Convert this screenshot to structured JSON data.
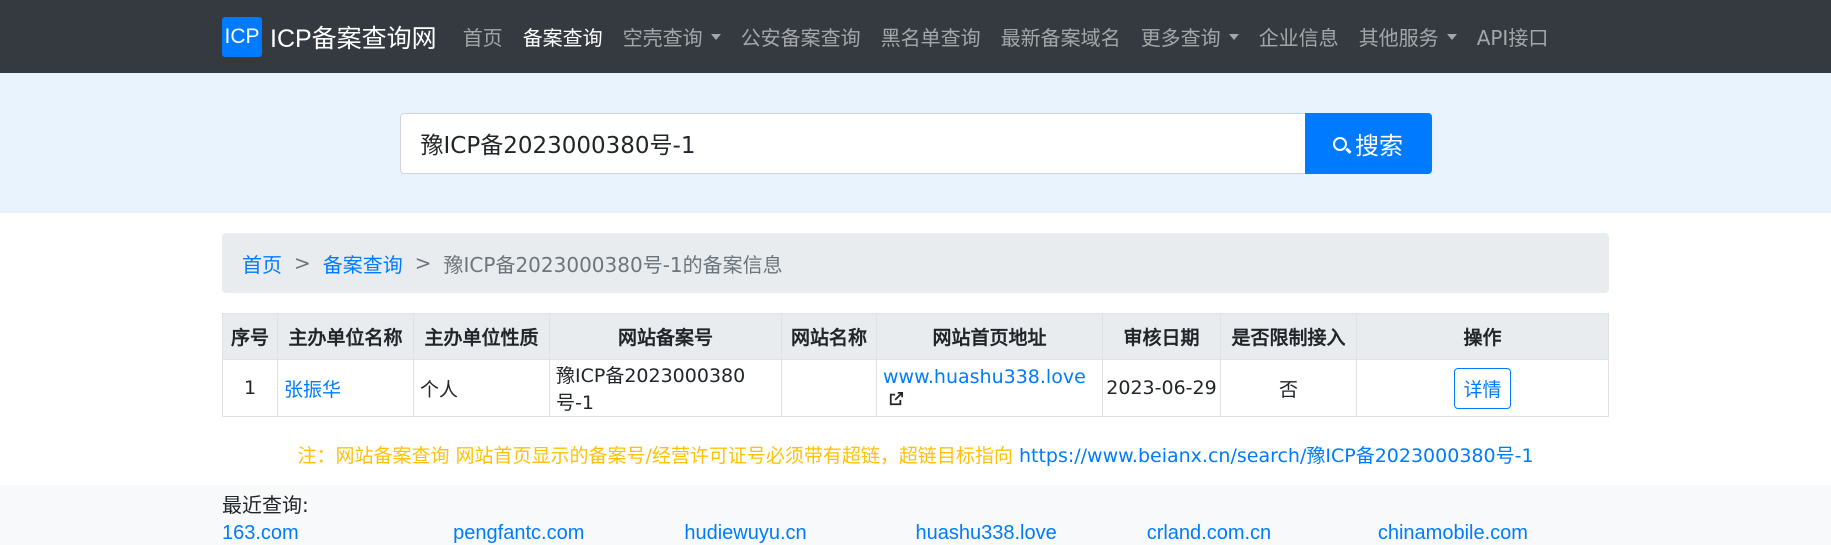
{
  "nav": {
    "brand_logo": "ICP",
    "brand_name": "ICP备案查询网",
    "items": [
      {
        "label": "首页"
      },
      {
        "label": "备案查询"
      },
      {
        "label": "空壳查询"
      },
      {
        "label": "公安备案查询"
      },
      {
        "label": "黑名单查询"
      },
      {
        "label": "最新备案域名"
      },
      {
        "label": "更多查询"
      },
      {
        "label": "企业信息"
      },
      {
        "label": "其他服务"
      },
      {
        "label": "API接口"
      }
    ]
  },
  "search": {
    "value": "豫ICP备2023000380号-1",
    "button_label": "搜索"
  },
  "breadcrumb": {
    "home": "首页",
    "section": "备案查询",
    "separator": ">",
    "current": "豫ICP备2023000380号-1的备案信息"
  },
  "table": {
    "headers": [
      "序号",
      "主办单位名称",
      "主办单位性质",
      "网站备案号",
      "网站名称",
      "网站首页地址",
      "审核日期",
      "是否限制接入",
      "操作"
    ],
    "row": {
      "index": "1",
      "org_name": "张振华",
      "org_type": "个人",
      "icp_number": "豫ICP备2023000380号-1",
      "site_name": "",
      "homepage": "www.huashu338.love",
      "review_date": "2023-06-29",
      "restricted": "否",
      "action": "详情"
    }
  },
  "note": {
    "text": "注：网站备案查询 网站首页显示的备案号/经营许可证号必须带有超链，超链目标指向 ",
    "link": "https://www.beianx.cn/search/豫ICP备2023000380号-1"
  },
  "recent": {
    "title": "最近查询:",
    "links": [
      "163.com",
      "pengfantc.com",
      "hudiewuyu.cn",
      "huashu338.love",
      "crland.com.cn",
      "chinamobile.com"
    ]
  },
  "colors": {
    "navbar": "#343a40",
    "accent": "#007bff",
    "hero": "#e8f3fd",
    "note": "#ffc107"
  }
}
